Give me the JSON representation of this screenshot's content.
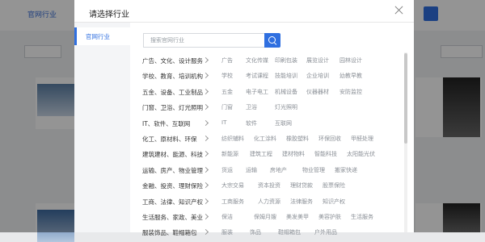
{
  "background": {
    "nav_link": "官网行业"
  },
  "modal": {
    "title": "请选择行业",
    "close_icon": "close-icon",
    "sidebar": {
      "active_item": "官网行业"
    },
    "search": {
      "placeholder": "搜索官网行业",
      "value": "",
      "icon": "search-icon"
    },
    "categories": [
      {
        "name": "广告、文化、设计服务",
        "subs": [
          "广告",
          "文化传媒",
          "印刷包装",
          "展览设计",
          "园林设计"
        ]
      },
      {
        "name": "学校、教育、培训机构",
        "subs": [
          "学校",
          "考试课程",
          "技能培训",
          "企业培训",
          "幼教早教"
        ]
      },
      {
        "name": "五金、设备、工业制品",
        "subs": [
          "五金",
          "电子电工",
          "机械设备",
          "仪器器材",
          "安防监控"
        ]
      },
      {
        "name": "门窗、卫浴、灯光照明",
        "subs": [
          "门窗",
          "卫浴",
          "灯光照明"
        ]
      },
      {
        "name": "IT、软件、互联网",
        "subs": [
          "IT",
          "软件",
          "互联网"
        ]
      },
      {
        "name": "化工、原材料、环保",
        "subs": [
          "纺织辅料",
          "化工涂料",
          "橡胶塑料",
          "环保回收",
          "甲醛处理"
        ]
      },
      {
        "name": "建筑建材、能源、科技",
        "subs": [
          "新能源",
          "建筑工程",
          "建材物料",
          "智能科技",
          "太阳能光伏"
        ]
      },
      {
        "name": "运输、房产、物业管理",
        "subs": [
          "货运",
          "运输",
          "房地产",
          "物业管理",
          "搬家快递"
        ]
      },
      {
        "name": "金融、投资、理财保险",
        "subs": [
          "大宗交易",
          "资本投资",
          "理财贷款",
          "股票保险"
        ]
      },
      {
        "name": "工商、法律、知识产权",
        "subs": [
          "工商服务",
          "人力资源",
          "法律服务",
          "知识产权"
        ]
      },
      {
        "name": "生活服务、家政、美业",
        "subs": [
          "保洁",
          "保姆月嫂",
          "美发美甲",
          "美容护肤",
          "生活服务"
        ]
      },
      {
        "name": "服装饰品、鞋帽箱包",
        "subs": [
          "服装",
          "饰品",
          "鞋帽箱包",
          "户外用品"
        ]
      }
    ]
  }
}
